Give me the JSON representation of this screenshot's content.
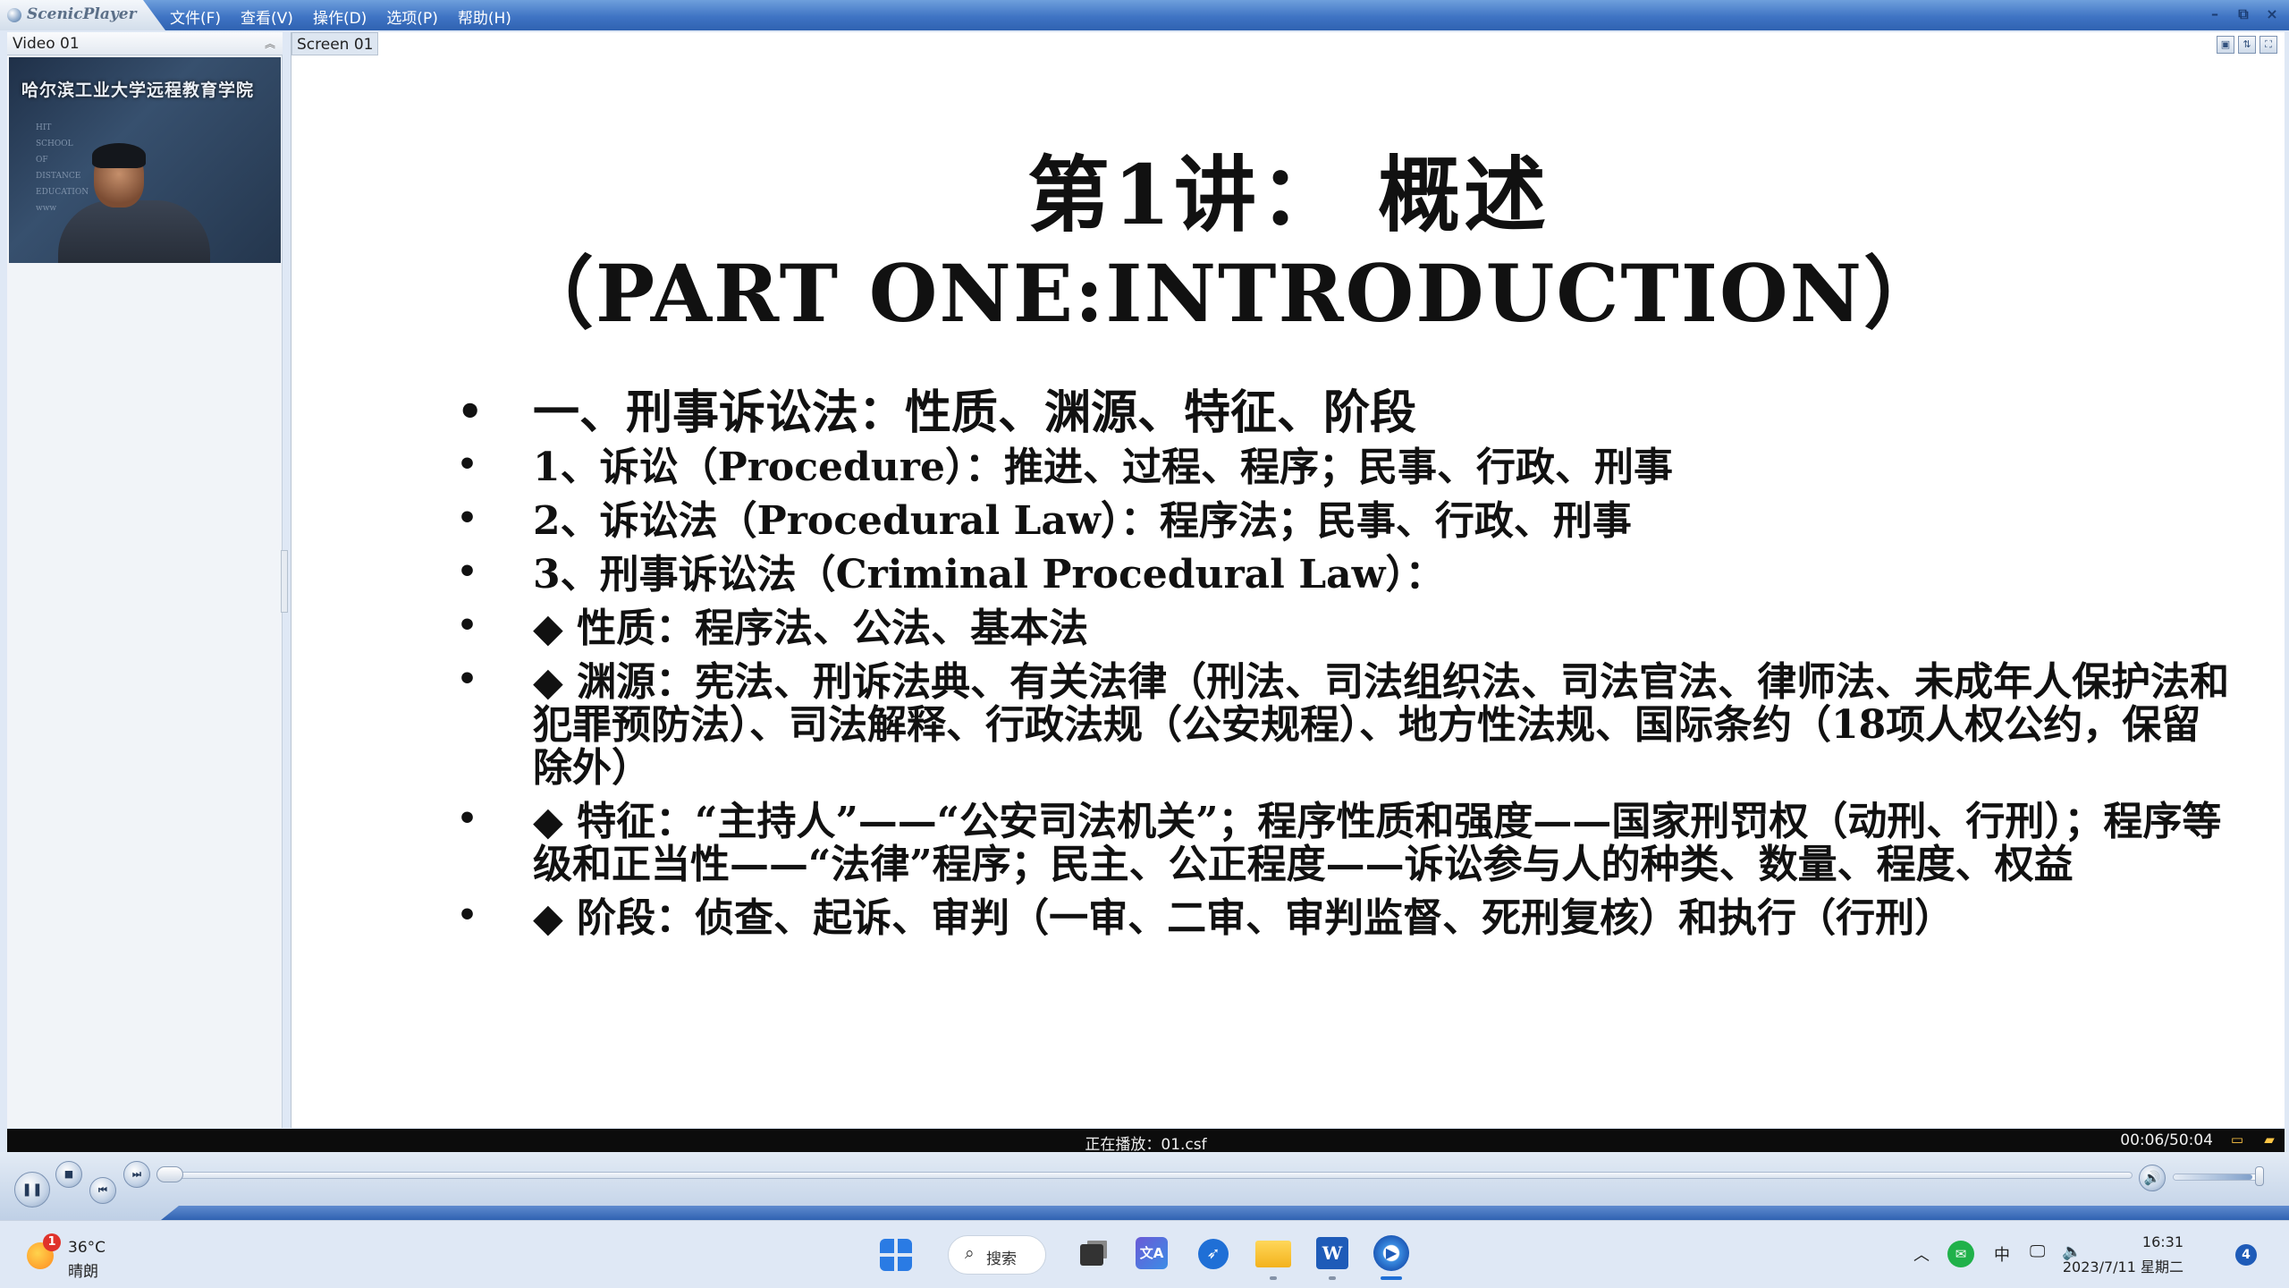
{
  "app": {
    "name": "ScenicPlayer",
    "menu": [
      "文件(F)",
      "查看(V)",
      "操作(D)",
      "选项(P)",
      "帮助(H)"
    ],
    "window_controls": [
      "–",
      "⧉",
      "×"
    ]
  },
  "video_panel": {
    "title": "Video 01",
    "banner_text": "哈尔滨工业大学远程教育学院",
    "watermark_lines": [
      "HIT",
      "SCHOOL",
      "OF",
      "DISTANCE",
      "EDUCATION",
      "www"
    ]
  },
  "screen_panel": {
    "tab_label": "Screen 01"
  },
  "slide": {
    "title": "第1讲：  概述",
    "subtitle": "（PART ONE:INTRODUCTION）",
    "bullets": [
      {
        "style": "big",
        "text": "一、刑事诉讼法：性质、渊源、特征、阶段"
      },
      {
        "style": "normal",
        "text": "1、诉讼（Procedure）：推进、过程、程序；民事、行政、刑事"
      },
      {
        "style": "normal",
        "text": "2、诉讼法（Procedural Law）：程序法；民事、行政、刑事"
      },
      {
        "style": "normal",
        "text": "3、刑事诉讼法（Criminal Procedural Law）："
      },
      {
        "style": "normal",
        "text": "◆ 性质：程序法、公法、基本法"
      },
      {
        "style": "multi",
        "text": "◆ 渊源：宪法、刑诉法典、有关法律（刑法、司法组织法、司法官法、律师法、未成年人保护法和犯罪预防法）、司法解释、行政法规（公安规程）、地方性法规、国际条约（18项人权公约，保留除外）"
      },
      {
        "style": "multi",
        "text": "◆ 特征：“主持人”——“公安司法机关”；程序性质和强度——国家刑罚权（动刑、行刑）；程序等级和正当性——“法律”程序；民主、公正程度——诉讼参与人的种类、数量、程度、权益"
      },
      {
        "style": "multi",
        "text": "◆ 阶段：侦查、起诉、审判（一审、二审、审判监督、死刑复核）和执行（行刑）"
      }
    ]
  },
  "status": {
    "now_playing": "正在播放：01.csf",
    "time": "00:06/50:04"
  },
  "playback": {
    "progress_fraction": 0.002,
    "volume_fraction": 0.9
  },
  "taskbar": {
    "weather_temp": "36°C",
    "weather_desc": "晴朗",
    "weather_badge": "1",
    "search_label": "搜索",
    "ime": "中",
    "clock_time": "16:31",
    "clock_date": "2023/7/11 星期二",
    "notification_count": "4"
  },
  "colors": {
    "titlebar": "#3f74c4",
    "status_bar": "#0c0c0c",
    "accent": "#1f6fd6"
  }
}
